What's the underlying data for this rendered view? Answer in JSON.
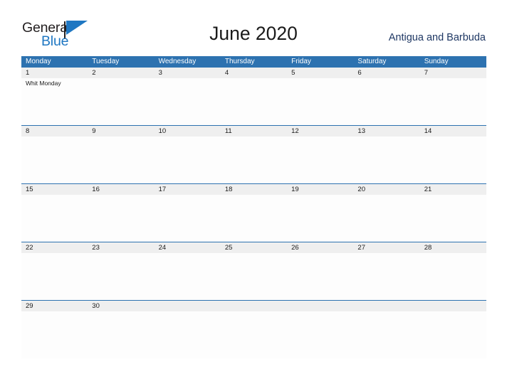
{
  "brand": {
    "name_part1": "General",
    "name_part2": "Blue",
    "color_dark": "#231f20",
    "color_blue": "#1f77c2"
  },
  "header": {
    "month_title": "June 2020",
    "country": "Antigua and Barbuda"
  },
  "theme": {
    "header_blue": "#2d72b0",
    "date_band_gray": "#efefef",
    "cell_white": "#fdfdfd",
    "country_text": "#1f3864"
  },
  "calendar": {
    "weekday_headers": [
      "Monday",
      "Tuesday",
      "Wednesday",
      "Thursday",
      "Friday",
      "Saturday",
      "Sunday"
    ],
    "weeks": [
      {
        "days": [
          {
            "num": "1",
            "events": [
              "Whit Monday"
            ]
          },
          {
            "num": "2",
            "events": []
          },
          {
            "num": "3",
            "events": []
          },
          {
            "num": "4",
            "events": []
          },
          {
            "num": "5",
            "events": []
          },
          {
            "num": "6",
            "events": []
          },
          {
            "num": "7",
            "events": []
          }
        ]
      },
      {
        "days": [
          {
            "num": "8",
            "events": []
          },
          {
            "num": "9",
            "events": []
          },
          {
            "num": "10",
            "events": []
          },
          {
            "num": "11",
            "events": []
          },
          {
            "num": "12",
            "events": []
          },
          {
            "num": "13",
            "events": []
          },
          {
            "num": "14",
            "events": []
          }
        ]
      },
      {
        "days": [
          {
            "num": "15",
            "events": []
          },
          {
            "num": "16",
            "events": []
          },
          {
            "num": "17",
            "events": []
          },
          {
            "num": "18",
            "events": []
          },
          {
            "num": "19",
            "events": []
          },
          {
            "num": "20",
            "events": []
          },
          {
            "num": "21",
            "events": []
          }
        ]
      },
      {
        "days": [
          {
            "num": "22",
            "events": []
          },
          {
            "num": "23",
            "events": []
          },
          {
            "num": "24",
            "events": []
          },
          {
            "num": "25",
            "events": []
          },
          {
            "num": "26",
            "events": []
          },
          {
            "num": "27",
            "events": []
          },
          {
            "num": "28",
            "events": []
          }
        ]
      },
      {
        "days": [
          {
            "num": "29",
            "events": []
          },
          {
            "num": "30",
            "events": []
          },
          {
            "num": "",
            "events": []
          },
          {
            "num": "",
            "events": []
          },
          {
            "num": "",
            "events": []
          },
          {
            "num": "",
            "events": []
          },
          {
            "num": "",
            "events": []
          }
        ]
      }
    ]
  }
}
